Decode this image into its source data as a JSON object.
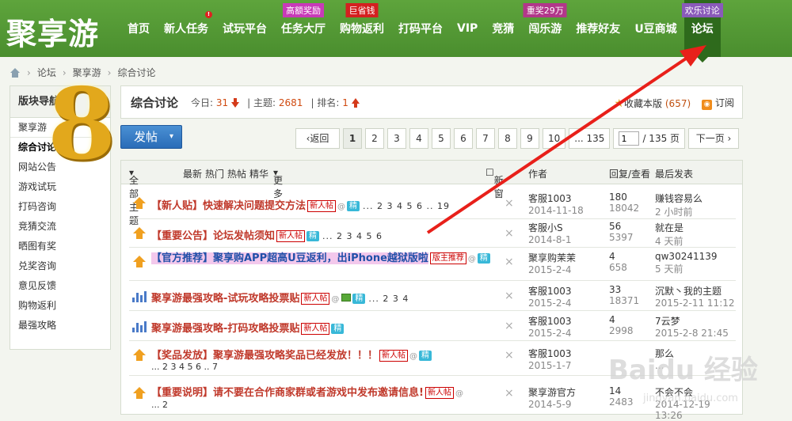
{
  "logo": "聚享游",
  "nav": [
    {
      "label": "首页"
    },
    {
      "label": "新人任务",
      "dot": "!"
    },
    {
      "label": "试玩平台"
    },
    {
      "label": "任务大厅",
      "badge": "高额奖励"
    },
    {
      "label": "购物返利",
      "badge": "巨省钱"
    },
    {
      "label": "打码平台"
    },
    {
      "label": "VIP"
    },
    {
      "label": "竞猜"
    },
    {
      "label": "闯乐游",
      "badge": "重奖29万"
    },
    {
      "label": "推荐好友"
    },
    {
      "label": "U豆商城"
    },
    {
      "label": "论坛",
      "badge": "欢乐讨论"
    }
  ],
  "breadcrumb": [
    "论坛",
    "聚享游",
    "综合讨论"
  ],
  "sidebar": {
    "title": "版块导航",
    "items": [
      "聚享游",
      "综合讨论",
      "网站公告",
      "游戏试玩",
      "打码咨询",
      "竞猜交流",
      "晒图有奖",
      "兑奖咨询",
      "意见反馈",
      "购物返利",
      "最强攻略"
    ]
  },
  "overlay_number": "8",
  "forum": {
    "title": "综合讨论",
    "today_label": "今日:",
    "today": "31",
    "topics_label": "主题:",
    "topics": "2681",
    "rank_label": "排名:",
    "rank": "1",
    "fav_label": "收藏本版",
    "fav_count": "(657)",
    "rss_label": "订阅"
  },
  "post_button": "发帖",
  "pager": {
    "back": "返回",
    "pages": [
      "1",
      "2",
      "3",
      "4",
      "5",
      "6",
      "7",
      "8",
      "9",
      "10"
    ],
    "ellipsis_last": "... 135",
    "input_value": "1",
    "total": "/ 135 页",
    "next": "下一页"
  },
  "table_header": {
    "filter": "全部主题",
    "links": [
      "最新",
      "热门",
      "热帖",
      "精华"
    ],
    "more": "更多",
    "new_check": "新窗",
    "author": "作者",
    "replies": "回复/查看",
    "last": "最后发表"
  },
  "threads": [
    {
      "title": "【新人贴】快速解决问题提交方法",
      "tag": "新人帖",
      "jing": "精",
      "pages": "... 2 3 4 5 6 .. 19",
      "author": "客服1003",
      "date": "2014-11-18",
      "replies": "180",
      "views": "18042",
      "last_user": "赚钱容易么",
      "last_time": "2 小时前"
    },
    {
      "title": "【重要公告】论坛发帖须知",
      "tag": "新人帖",
      "jing": "精",
      "pages": "... 2 3 4 5 6",
      "author": "客服小S",
      "date": "2014-8-1",
      "replies": "56",
      "views": "5397",
      "last_user": "就在是",
      "last_time": "4 天前"
    },
    {
      "title": "【官方推荐】聚享购APP超高U豆返利，出iPhone越狱版啦",
      "tag": "版主推荐",
      "jing": "精",
      "author": "聚享购茉茉",
      "date": "2015-2-4",
      "replies": "4",
      "views": "658",
      "last_user": "qw30241139",
      "last_time": "5 天前"
    },
    {
      "title": "聚享游最强攻略-试玩攻略投票贴",
      "tag": "新人帖",
      "jing": "精",
      "pages": "... 2 3 4",
      "author": "客服1003",
      "date": "2015-2-4",
      "replies": "33",
      "views": "18371",
      "last_user": "沉默丶我的主题",
      "last_time": "2015-2-11 11:12"
    },
    {
      "title": "聚享游最强攻略-打码攻略投票贴",
      "tag": "新人帖",
      "jing": "精",
      "author": "客服1003",
      "date": "2015-2-4",
      "replies": "4",
      "views": "2998",
      "last_user": "7云梦",
      "last_time": "2015-2-8 21:45"
    },
    {
      "title": "【奖品发放】聚享游最强攻略奖品已经发放！！！",
      "tag": "新人帖",
      "jing": "精",
      "pages": "... 2 3 4 5 6 .. 7",
      "author": "客服1003",
      "date": "2015-1-7",
      "replies": "",
      "views": "",
      "last_user": "那么",
      "last_time": "..."
    },
    {
      "title": "【重要说明】请不要在合作商家群或者游戏中发布邀请信息!",
      "tag": "新人帖",
      "pages": "... 2",
      "author": "聚享游官方",
      "date": "2014-5-9",
      "replies": "14",
      "views": "2483",
      "last_user": "不会不会",
      "last_time": "2014-12-19 13:26"
    }
  ],
  "watermark": "Baidu 经验",
  "watermark_url": "jingyan.baidu.com"
}
